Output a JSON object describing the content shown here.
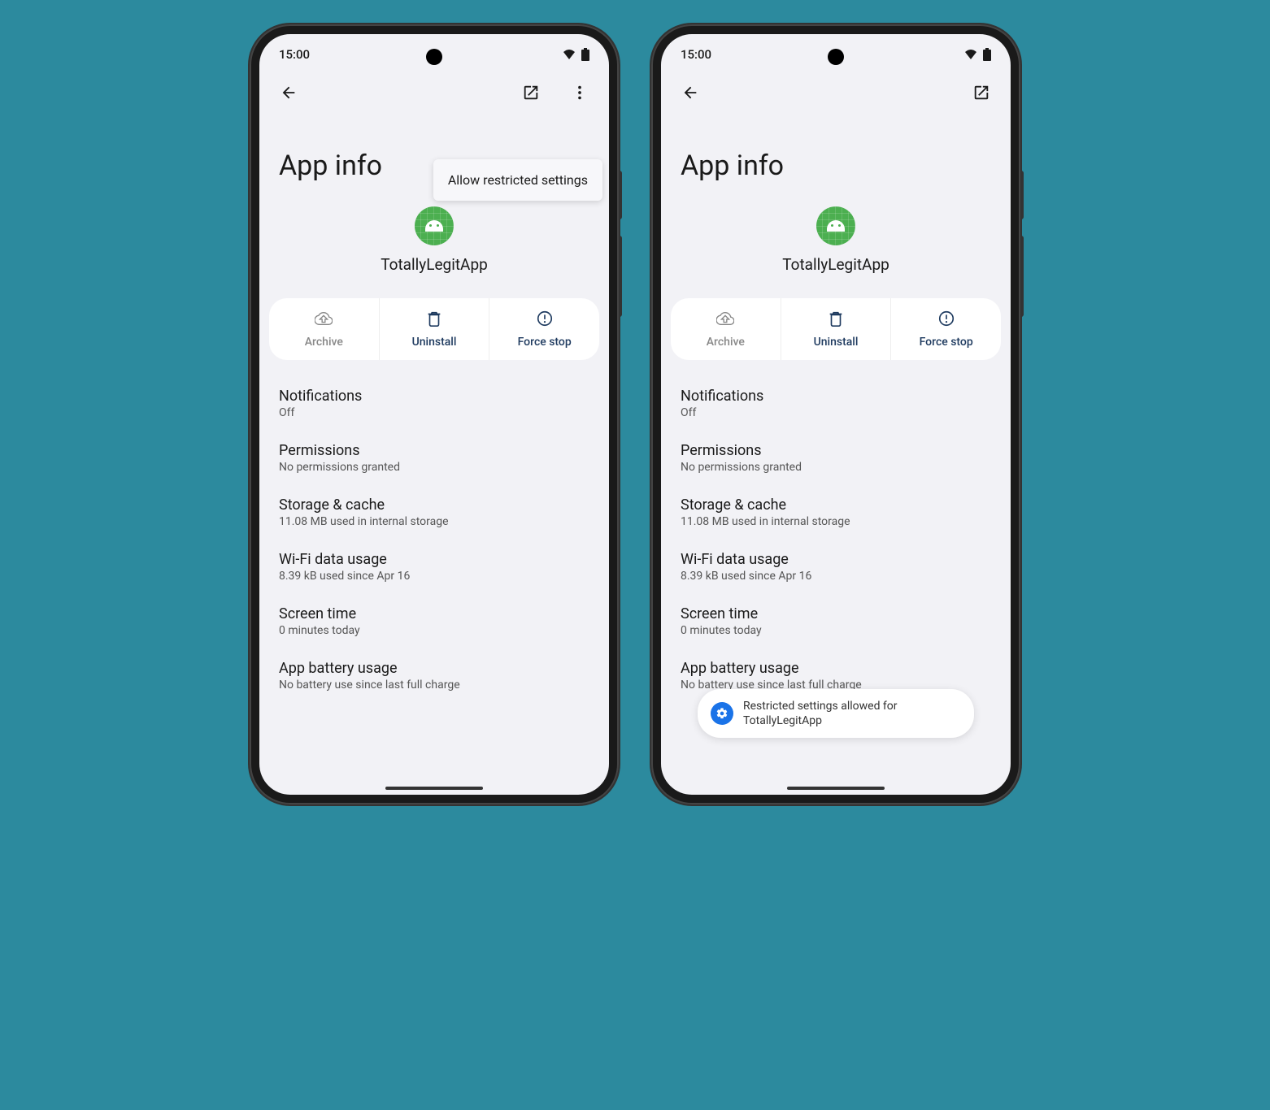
{
  "status": {
    "time": "15:00"
  },
  "popup": {
    "label": "Allow restricted settings"
  },
  "page": {
    "title": "App info"
  },
  "app": {
    "name": "TotallyLegitApp"
  },
  "actions": {
    "archive": "Archive",
    "uninstall": "Uninstall",
    "forcestop": "Force stop"
  },
  "settings": {
    "notifications": {
      "title": "Notifications",
      "sub": "Off"
    },
    "permissions": {
      "title": "Permissions",
      "sub": "No permissions granted"
    },
    "storage": {
      "title": "Storage & cache",
      "sub": "11.08 MB used in internal storage"
    },
    "wifi": {
      "title": "Wi-Fi data usage",
      "sub": "8.39 kB used since Apr 16"
    },
    "screentime": {
      "title": "Screen time",
      "sub": "0 minutes today"
    },
    "battery": {
      "title": "App battery usage",
      "sub": "No battery use since last full charge"
    }
  },
  "toast": {
    "text": "Restricted settings allowed for TotallyLegitApp"
  }
}
